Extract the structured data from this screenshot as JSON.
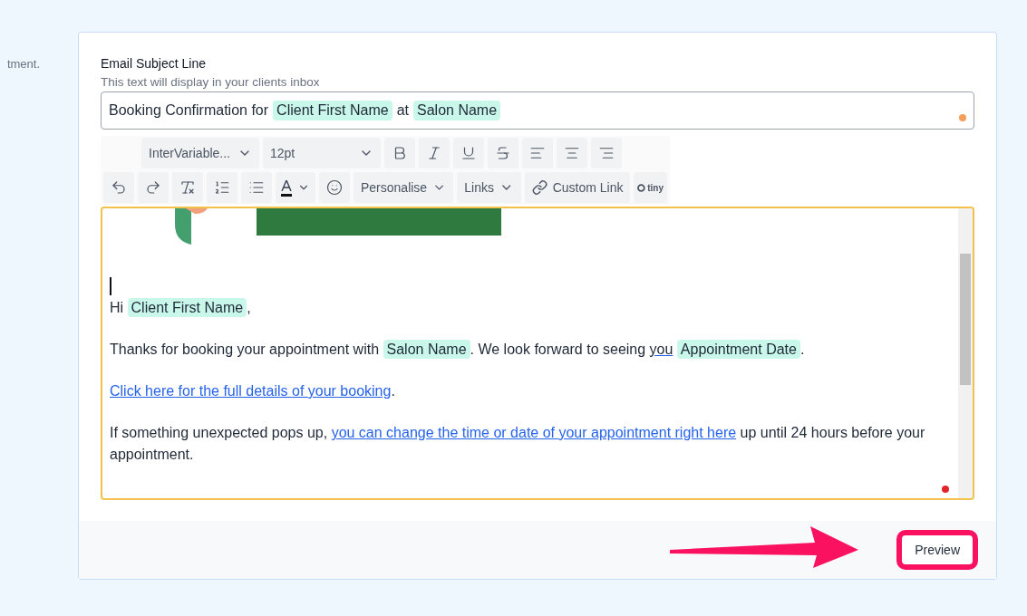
{
  "side_note": "tment.",
  "subject": {
    "label": "Email Subject Line",
    "hint": "This text will display in your clients inbox",
    "parts": [
      {
        "kind": "text",
        "text": "Booking Confirmation for"
      },
      {
        "kind": "token",
        "text": "Client First Name"
      },
      {
        "kind": "text",
        "text": "at"
      },
      {
        "kind": "token",
        "text": "Salon Name"
      }
    ]
  },
  "toolbar": {
    "font": "InterVariable...",
    "size": "12pt",
    "menus": [
      "Personalise",
      "Links"
    ],
    "custom_link": "Custom Link",
    "brand": "tiny"
  },
  "paragraphs": [
    [
      {
        "kind": "text",
        "text": "Hi"
      },
      {
        "kind": "token",
        "text": "Client First Name"
      },
      {
        "kind": "text",
        "text": ","
      }
    ],
    [
      {
        "kind": "text",
        "text": "Thanks for booking your appointment with"
      },
      {
        "kind": "token",
        "text": "Salon Name"
      },
      {
        "kind": "text",
        "text": ". We look forward to seeing"
      },
      {
        "kind": "spell",
        "text": "you"
      },
      {
        "kind": "token",
        "text": "Appointment Date"
      },
      {
        "kind": "text",
        "text": "."
      }
    ],
    [
      {
        "kind": "link",
        "text": "Click here for the full details of your booking"
      },
      {
        "kind": "text",
        "text": "."
      }
    ],
    [
      {
        "kind": "text",
        "text": "If something unexpected pops up,"
      },
      {
        "kind": "link",
        "text": "you can change the time or date of your appointment right here"
      },
      {
        "kind": "text",
        "text": "up until 24 hours before your appointment."
      }
    ]
  ],
  "preview_button": "Preview"
}
